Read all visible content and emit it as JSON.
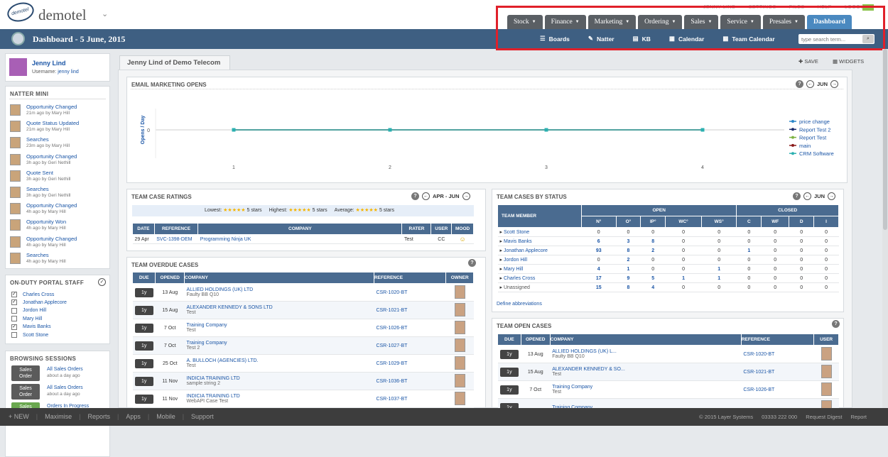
{
  "top": {
    "brand": "demotel",
    "logo_text": "demotel",
    "user_links": [
      "JENNY LIND",
      "SETTINGS",
      "FILES",
      "HELP",
      "LOGOUT"
    ]
  },
  "tabs": [
    {
      "label": "Stock"
    },
    {
      "label": "Finance"
    },
    {
      "label": "Marketing"
    },
    {
      "label": "Ordering"
    },
    {
      "label": "Sales"
    },
    {
      "label": "Service"
    },
    {
      "label": "Presales"
    },
    {
      "label": "Dashboard",
      "active": true
    }
  ],
  "dashbar": {
    "title": "Dashboard - 5 June, 2015"
  },
  "subnav": [
    {
      "label": "Boards",
      "icon": "list-icon"
    },
    {
      "label": "Natter",
      "icon": "chat-icon"
    },
    {
      "label": "KB",
      "icon": "book-icon"
    },
    {
      "label": "Calendar",
      "icon": "calendar-icon"
    },
    {
      "label": "Team Calendar",
      "icon": "calendar-icon"
    }
  ],
  "search": {
    "placeholder": "type search term..."
  },
  "profile": {
    "name": "Jenny Lind",
    "username_label": "Username:",
    "username": "jenny lind"
  },
  "natter": {
    "title": "NATTER MINI",
    "items": [
      {
        "t": "Opportunity Changed",
        "s": "21m ago by Mary Hill"
      },
      {
        "t": "Quote Status Updated",
        "s": "21m ago by Mary Hill"
      },
      {
        "t": "Searches",
        "s": "23m ago by Mary Hill"
      },
      {
        "t": "Opportunity Changed",
        "s": "3h ago by Geri Nethill"
      },
      {
        "t": "Quote Sent",
        "s": "3h ago by Geri Nethill"
      },
      {
        "t": "Searches",
        "s": "3h ago by Geri Nethill"
      },
      {
        "t": "Opportunity Changed",
        "s": "4h ago by Mary Hill"
      },
      {
        "t": "Opportunity Won",
        "s": "4h ago by Mary Hill"
      },
      {
        "t": "Opportunity Changed",
        "s": "4h ago by Mary Hill"
      },
      {
        "t": "Searches",
        "s": "4h ago by Mary Hill"
      }
    ]
  },
  "onduty": {
    "title": "ON-DUTY PORTAL STAFF",
    "items": [
      {
        "name": "Charles Cross",
        "checked": true
      },
      {
        "name": "Jonathan Applecore",
        "checked": true
      },
      {
        "name": "Jordon Hill",
        "checked": false
      },
      {
        "name": "Mary Hill",
        "checked": false
      },
      {
        "name": "Mavis Banks",
        "checked": true
      },
      {
        "name": "Scott Stone",
        "checked": false
      }
    ]
  },
  "browse": {
    "title": "BROWSING SESSIONS",
    "items": [
      {
        "btn1": "Sales",
        "btn2": "Order",
        "t": "All Sales Orders",
        "s": "about a day ago"
      },
      {
        "btn1": "Sales",
        "btn2": "Order",
        "t": "All Sales Orders",
        "s": "about a day ago"
      },
      {
        "btn1": "Sales",
        "btn2": "",
        "t": "Orders In Progress",
        "s": ""
      }
    ]
  },
  "main": {
    "tab": "Jenny Lind of Demo Telecom",
    "save": "SAVE",
    "widgets": "WIDGETS"
  },
  "email": {
    "title": "EMAIL MARKETING OPENS",
    "period": "JUN"
  },
  "chart_data": {
    "type": "line",
    "x": [
      1,
      2,
      3,
      4
    ],
    "ylabel": "Opens / Day",
    "y_ticks": [
      "0"
    ],
    "series": [
      {
        "name": "price change",
        "values": [
          0,
          0,
          0,
          0
        ],
        "color": "#2a86c8"
      },
      {
        "name": "Report Test 2",
        "values": [
          0,
          0,
          0,
          0
        ],
        "color": "#1a2a6a"
      },
      {
        "name": "Report Test",
        "values": [
          0,
          0,
          0,
          0
        ],
        "color": "#7cb342"
      },
      {
        "name": "main",
        "values": [
          0,
          0,
          0,
          0
        ],
        "color": "#8a1a1a"
      },
      {
        "name": "CRM Software",
        "values": [
          0,
          0,
          0,
          0
        ],
        "color": "#2bb0b0"
      }
    ]
  },
  "ratings": {
    "title": "TEAM CASE RATINGS",
    "period": "APR - JUN",
    "summary": [
      {
        "label": "Lowest:",
        "stars": "★★★★★",
        "val": "5 stars"
      },
      {
        "label": "Highest:",
        "stars": "★★★★★",
        "val": "5 stars"
      },
      {
        "label": "Average:",
        "stars": "★★★★★",
        "val": "5 stars"
      }
    ],
    "headers": [
      "DATE",
      "REFERENCE",
      "COMPANY",
      "RATER",
      "USER",
      "MOOD"
    ],
    "rows": [
      {
        "date": "29 Apr",
        "ref": "SVC-1398-DEM",
        "company": "Programming Ninja UK",
        "rater": "Test",
        "user": "CC",
        "mood": "☺"
      }
    ]
  },
  "overdue": {
    "title": "TEAM OVERDUE CASES",
    "headers": [
      "DUE",
      "OPENED",
      "COMPANY",
      "REFERENCE",
      "OWNER"
    ],
    "rows": [
      {
        "due": "1y",
        "opened": "13 Aug",
        "company": "ALLIED HOLDINGS (UK) LTD",
        "sub": "Faulty BB Q10",
        "ref": "CSR-1020-BT"
      },
      {
        "due": "1y",
        "opened": "15 Aug",
        "company": "ALEXANDER KENNEDY & SONS LTD",
        "sub": "Test",
        "ref": "CSR-1021-BT"
      },
      {
        "due": "1y",
        "opened": "7 Oct",
        "company": "Training Company",
        "sub": "Test",
        "ref": "CSR-1026-BT"
      },
      {
        "due": "1y",
        "opened": "7 Oct",
        "company": "Training Company",
        "sub": "Test 2",
        "ref": "CSR-1027-BT"
      },
      {
        "due": "1y",
        "opened": "25 Oct",
        "company": "A. BULLOCH (AGENCIES) LTD.",
        "sub": "Test",
        "ref": "CSR-1029-BT"
      },
      {
        "due": "1y",
        "opened": "11 Nov",
        "company": "INDICIA TRAINING LTD",
        "sub": "sample string 2",
        "ref": "CSR-1036-BT"
      },
      {
        "due": "1y",
        "opened": "11 Nov",
        "company": "INDICIA TRAINING LTD",
        "sub": "WebAPI Case Test",
        "ref": "CSR-1037-BT"
      }
    ]
  },
  "status": {
    "title": "TEAM CASES BY STATUS",
    "period": "JUN",
    "member_header": "TEAM MEMBER",
    "open": "OPEN",
    "closed": "CLOSED",
    "cols": [
      "N°",
      "O°",
      "IP°",
      "WC°",
      "WS°",
      "C",
      "WF",
      "D",
      "I"
    ],
    "rows": [
      {
        "name": "Scott Stone",
        "v": [
          "0",
          "0",
          "0",
          "0",
          "0",
          "0",
          "0",
          "0",
          "0"
        ]
      },
      {
        "name": "Mavis Banks",
        "v": [
          "6",
          "3",
          "8",
          "0",
          "0",
          "0",
          "0",
          "0",
          "0"
        ]
      },
      {
        "name": "Jonathan Applecore",
        "v": [
          "93",
          "8",
          "2",
          "0",
          "0",
          "1",
          "0",
          "0",
          "0"
        ]
      },
      {
        "name": "Jordon Hill",
        "v": [
          "0",
          "2",
          "0",
          "0",
          "0",
          "0",
          "0",
          "0",
          "0"
        ]
      },
      {
        "name": "Mary Hill",
        "v": [
          "4",
          "1",
          "0",
          "0",
          "1",
          "0",
          "0",
          "0",
          "0"
        ]
      },
      {
        "name": "Charles Cross",
        "v": [
          "17",
          "9",
          "5",
          "1",
          "1",
          "0",
          "0",
          "0",
          "0"
        ]
      },
      {
        "name": "Unassigned",
        "v": [
          "15",
          "8",
          "4",
          "0",
          "0",
          "0",
          "0",
          "0",
          "0"
        ]
      }
    ],
    "define": "Define abbreviations"
  },
  "openc": {
    "title": "TEAM OPEN CASES",
    "headers": [
      "DUE",
      "OPENED",
      "COMPANY",
      "REFERENCE",
      "USER"
    ],
    "rows": [
      {
        "due": "1y",
        "opened": "13 Aug",
        "company": "ALLIED HOLDINGS (UK) L...",
        "sub": "Faulty BB Q10",
        "ref": "CSR-1020-BT"
      },
      {
        "due": "1y",
        "opened": "15 Aug",
        "company": "ALEXANDER KENNEDY & SO...",
        "sub": "Test",
        "ref": "CSR-1021-BT"
      },
      {
        "due": "1y",
        "opened": "7 Oct",
        "company": "Training Company",
        "sub": "Test",
        "ref": "CSR-1026-BT"
      },
      {
        "due": "1y",
        "opened": "",
        "company": "Training Company",
        "sub": "",
        "ref": ""
      }
    ]
  },
  "statusbar": {
    "left": [
      "+ NEW",
      "Maximise",
      "Reports",
      "Apps",
      "Mobile",
      "Support"
    ],
    "right": [
      "© 2015 Layer Systems",
      "03333 222 000",
      "Request Digest",
      "Report"
    ]
  }
}
